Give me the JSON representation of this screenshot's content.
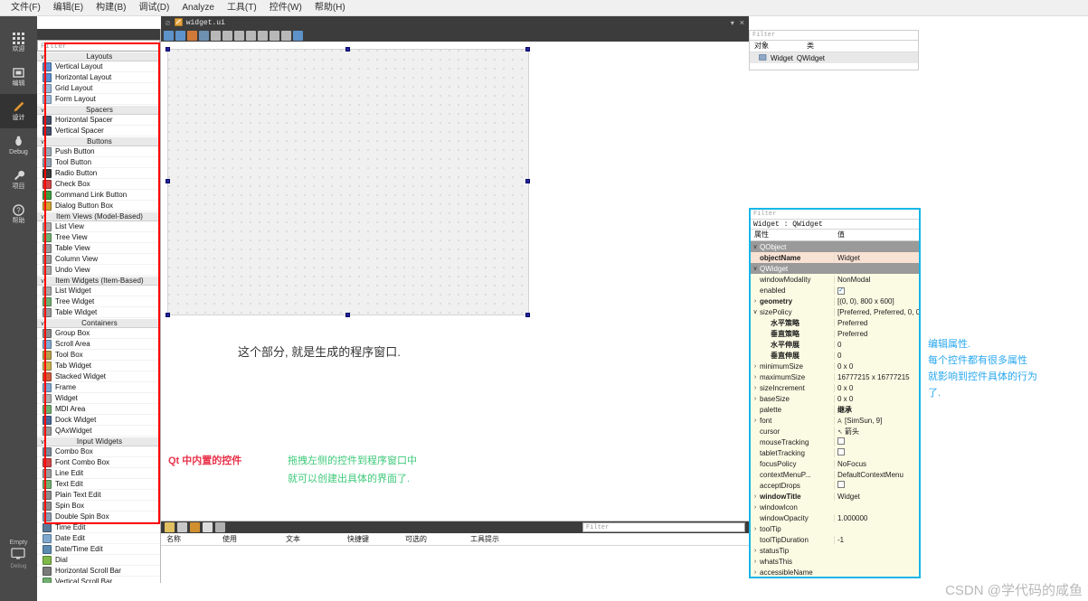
{
  "menubar": {
    "items": [
      {
        "label": "文件(F)"
      },
      {
        "label": "编辑(E)"
      },
      {
        "label": "构建(B)"
      },
      {
        "label": "调试(D)"
      },
      {
        "label": "Analyze"
      },
      {
        "label": "工具(T)"
      },
      {
        "label": "控件(W)"
      },
      {
        "label": "帮助(H)"
      }
    ]
  },
  "modebar": {
    "items": [
      {
        "label": "欢迎",
        "icon": "grid-icon",
        "active": false
      },
      {
        "label": "编辑",
        "icon": "editor-icon",
        "active": false
      },
      {
        "label": "设计",
        "icon": "pencil-icon",
        "active": true
      },
      {
        "label": "Debug",
        "icon": "bug-icon",
        "active": false
      },
      {
        "label": "项目",
        "icon": "wrench-icon",
        "active": false
      },
      {
        "label": "帮助",
        "icon": "question-icon",
        "active": false
      }
    ],
    "bottom": {
      "label": "Empty",
      "icon": "monitor-icon",
      "sublabel": "Debug"
    }
  },
  "widgetbox": {
    "filter_placeholder": "Filter",
    "groups": [
      {
        "title": "Layouts",
        "items": [
          {
            "label": "Vertical Layout",
            "icon": "vertical-layout-icon",
            "color": "#5b8fd0"
          },
          {
            "label": "Horizontal Layout",
            "icon": "horizontal-layout-icon",
            "color": "#5b8fd0"
          },
          {
            "label": "Grid Layout",
            "icon": "grid-layout-icon",
            "color": "#9bb8d8"
          },
          {
            "label": "Form Layout",
            "icon": "form-layout-icon",
            "color": "#9bb8d8"
          }
        ]
      },
      {
        "title": "Spacers",
        "items": [
          {
            "label": "Horizontal Spacer",
            "icon": "horizontal-spacer-icon",
            "color": "#43506b"
          },
          {
            "label": "Vertical Spacer",
            "icon": "vertical-spacer-icon",
            "color": "#43506b"
          }
        ]
      },
      {
        "title": "Buttons",
        "items": [
          {
            "label": "Push Button",
            "icon": "push-button-icon",
            "color": "#9aa7b5"
          },
          {
            "label": "Tool Button",
            "icon": "tool-button-icon",
            "color": "#8fa0b0"
          },
          {
            "label": "Radio Button",
            "icon": "radio-button-icon",
            "color": "#3a3a3a"
          },
          {
            "label": "Check Box",
            "icon": "check-box-icon",
            "color": "#d04545"
          },
          {
            "label": "Command Link Button",
            "icon": "command-link-icon",
            "color": "#3c9b3c"
          },
          {
            "label": "Dialog Button Box",
            "icon": "dialog-button-box-icon",
            "color": "#d0a030"
          }
        ]
      },
      {
        "title": "Item Views (Model-Based)",
        "items": [
          {
            "label": "List View",
            "icon": "list-view-icon",
            "color": "#a8a8a8"
          },
          {
            "label": "Tree View",
            "icon": "tree-view-icon",
            "color": "#6fae6f"
          },
          {
            "label": "Table View",
            "icon": "table-view-icon",
            "color": "#9a9a9a"
          },
          {
            "label": "Column View",
            "icon": "column-view-icon",
            "color": "#9a9a9a"
          },
          {
            "label": "Undo View",
            "icon": "undo-view-icon",
            "color": "#a8a8a8"
          }
        ]
      },
      {
        "title": "Item Widgets (Item-Based)",
        "items": [
          {
            "label": "List Widget",
            "icon": "list-widget-icon",
            "color": "#a8a8a8"
          },
          {
            "label": "Tree Widget",
            "icon": "tree-widget-icon",
            "color": "#6fae6f"
          },
          {
            "label": "Table Widget",
            "icon": "table-widget-icon",
            "color": "#9a9a9a"
          }
        ]
      },
      {
        "title": "Containers",
        "items": [
          {
            "label": "Group Box",
            "icon": "group-box-icon",
            "color": "#8a8a8a"
          },
          {
            "label": "Scroll Area",
            "icon": "scroll-area-icon",
            "color": "#7fa8d0"
          },
          {
            "label": "Tool Box",
            "icon": "tool-box-icon",
            "color": "#b5a04a"
          },
          {
            "label": "Tab Widget",
            "icon": "tab-widget-icon",
            "color": "#c8b050"
          },
          {
            "label": "Stacked Widget",
            "icon": "stacked-widget-icon",
            "color": "#d05a3a"
          },
          {
            "label": "Frame",
            "icon": "frame-icon",
            "color": "#7fa8d0"
          },
          {
            "label": "Widget",
            "icon": "widget-icon",
            "color": "#b0b0b0"
          },
          {
            "label": "MDI Area",
            "icon": "mdi-area-icon",
            "color": "#6fae6f"
          },
          {
            "label": "Dock Widget",
            "icon": "dock-widget-icon",
            "color": "#4a6a9a"
          },
          {
            "label": "QAxWidget",
            "icon": "qax-widget-icon",
            "color": "#9a9a9a"
          }
        ]
      },
      {
        "title": "Input Widgets",
        "items": [
          {
            "label": "Combo Box",
            "icon": "combo-box-icon",
            "color": "#7a8a9a"
          },
          {
            "label": "Font Combo Box",
            "icon": "font-combo-box-icon",
            "color": "#d04545"
          },
          {
            "label": "Line Edit",
            "icon": "line-edit-icon",
            "color": "#9a9a9a"
          },
          {
            "label": "Text Edit",
            "icon": "text-edit-icon",
            "color": "#6fae6f"
          },
          {
            "label": "Plain Text Edit",
            "icon": "plain-text-edit-icon",
            "color": "#8a8a8a"
          },
          {
            "label": "Spin Box",
            "icon": "spin-box-icon",
            "color": "#8a8a8a"
          },
          {
            "label": "Double Spin Box",
            "icon": "double-spin-box-icon",
            "color": "#8a9ab0"
          },
          {
            "label": "Time Edit",
            "icon": "time-edit-icon",
            "color": "#5a7a9a"
          },
          {
            "label": "Date Edit",
            "icon": "date-edit-icon",
            "color": "#7fa8d0"
          },
          {
            "label": "Date/Time Edit",
            "icon": "date-time-edit-icon",
            "color": "#5a8ab0"
          },
          {
            "label": "Dial",
            "icon": "dial-icon",
            "color": "#7fb84a"
          },
          {
            "label": "Horizontal Scroll Bar",
            "icon": "horizontal-scroll-bar-icon",
            "color": "#7a7a7a"
          },
          {
            "label": "Vertical Scroll Bar",
            "icon": "vertical-scroll-bar-icon",
            "color": "#6fae6f"
          }
        ]
      }
    ]
  },
  "formtab": {
    "filename": "widget.ui",
    "close_label": "×",
    "dropdown_label": "▾"
  },
  "canvas": {
    "form_width": 800,
    "form_height": 600
  },
  "annotations": {
    "form_note": "这个部分, 就是生成的程序窗口.",
    "widgetbox_note": "Qt 中内置的控件",
    "drag_note_line1": "拖拽左侧的控件到程序窗口中",
    "drag_note_line2": "就可以创建出具体的界面了.",
    "property_note_line1": "编辑属性.",
    "property_note_line2": "每个控件都有很多属性",
    "property_note_line3": "就影响到控件具体的行为",
    "property_note_line4": "了."
  },
  "object_inspector": {
    "filter_placeholder": "Filter",
    "columns": [
      "对象",
      "类"
    ],
    "rows": [
      {
        "object": "Widget",
        "class": "QWidget",
        "icon": "widget-node-icon"
      }
    ]
  },
  "property_editor": {
    "filter_placeholder": "Filter",
    "object_line": "Widget : QWidget",
    "columns": [
      "属性",
      "值"
    ],
    "rows": [
      {
        "caret": "v",
        "name": "QObject",
        "value": "",
        "kind": "group"
      },
      {
        "caret": "",
        "name": "objectName",
        "value": "Widget",
        "kind": "highlight",
        "bold": true
      },
      {
        "caret": "v",
        "name": "QWidget",
        "value": "",
        "kind": "group"
      },
      {
        "caret": "",
        "name": "windowModality",
        "value": "NonModal",
        "kind": "alt"
      },
      {
        "caret": "",
        "name": "enabled",
        "value": "",
        "kind": "alt",
        "checkbox": true,
        "checked": true
      },
      {
        "caret": ">",
        "name": "geometry",
        "value": "[(0, 0), 800 x 600]",
        "kind": "alt",
        "bold": true
      },
      {
        "caret": "v",
        "name": "sizePolicy",
        "value": "[Preferred, Preferred, 0, 0]",
        "kind": "alt"
      },
      {
        "caret": "",
        "name": "水平策略",
        "value": "Preferred",
        "kind": "alt",
        "indent": true,
        "bold": true
      },
      {
        "caret": "",
        "name": "垂直策略",
        "value": "Preferred",
        "kind": "alt",
        "indent": true,
        "bold": true
      },
      {
        "caret": "",
        "name": "水平伸展",
        "value": "0",
        "kind": "alt",
        "indent": true,
        "bold": true
      },
      {
        "caret": "",
        "name": "垂直伸展",
        "value": "0",
        "kind": "alt",
        "indent": true,
        "bold": true
      },
      {
        "caret": ">",
        "name": "minimumSize",
        "value": "0 x 0",
        "kind": "alt"
      },
      {
        "caret": ">",
        "name": "maximumSize",
        "value": "16777215 x 16777215",
        "kind": "alt"
      },
      {
        "caret": ">",
        "name": "sizeIncrement",
        "value": "0 x 0",
        "kind": "alt"
      },
      {
        "caret": ">",
        "name": "baseSize",
        "value": "0 x 0",
        "kind": "alt"
      },
      {
        "caret": "",
        "name": "palette",
        "value": "继承",
        "kind": "alt",
        "bold_value": true
      },
      {
        "caret": ">",
        "name": "font",
        "value": "[SimSun, 9]",
        "kind": "alt",
        "value_icon": "font-icon"
      },
      {
        "caret": "",
        "name": "cursor",
        "value": "箭头",
        "kind": "alt",
        "value_icon": "cursor-icon"
      },
      {
        "caret": "",
        "name": "mouseTracking",
        "value": "",
        "kind": "alt",
        "checkbox": true,
        "checked": false
      },
      {
        "caret": "",
        "name": "tabletTracking",
        "value": "",
        "kind": "alt",
        "checkbox": true,
        "checked": false
      },
      {
        "caret": "",
        "name": "focusPolicy",
        "value": "NoFocus",
        "kind": "alt"
      },
      {
        "caret": "",
        "name": "contextMenuP...",
        "value": "DefaultContextMenu",
        "kind": "alt"
      },
      {
        "caret": "",
        "name": "acceptDrops",
        "value": "",
        "kind": "alt",
        "checkbox": true,
        "checked": false
      },
      {
        "caret": ">",
        "name": "windowTitle",
        "value": "Widget",
        "kind": "alt",
        "bold": true
      },
      {
        "caret": ">",
        "name": "windowIcon",
        "value": "",
        "kind": "alt"
      },
      {
        "caret": "",
        "name": "windowOpacity",
        "value": "1.000000",
        "kind": "alt"
      },
      {
        "caret": ">",
        "name": "toolTip",
        "value": "",
        "kind": "alt"
      },
      {
        "caret": "",
        "name": "toolTipDuration",
        "value": "-1",
        "kind": "alt"
      },
      {
        "caret": ">",
        "name": "statusTip",
        "value": "",
        "kind": "alt"
      },
      {
        "caret": ">",
        "name": "whatsThis",
        "value": "",
        "kind": "alt"
      },
      {
        "caret": ">",
        "name": "accessibleName",
        "value": "",
        "kind": "alt"
      }
    ]
  },
  "action_editor": {
    "filter_placeholder": "Filter",
    "columns": [
      "名称",
      "使用",
      "文本",
      "快捷键",
      "可选的",
      "工具提示"
    ],
    "toolbar_icons": [
      "new-action-icon",
      "copy-action-icon",
      "edit-action-icon",
      "delete-action-icon",
      "configure-icon"
    ]
  },
  "watermark": {
    "text": "CSDN @学代码的咸鱼"
  },
  "colors": {
    "accent_blue": "#17b6e8",
    "annotation_red": "#e8324a",
    "annotation_green": "#3ec97a",
    "chrome_dark": "#3c3c3c",
    "sidebar_dark": "#494949"
  }
}
